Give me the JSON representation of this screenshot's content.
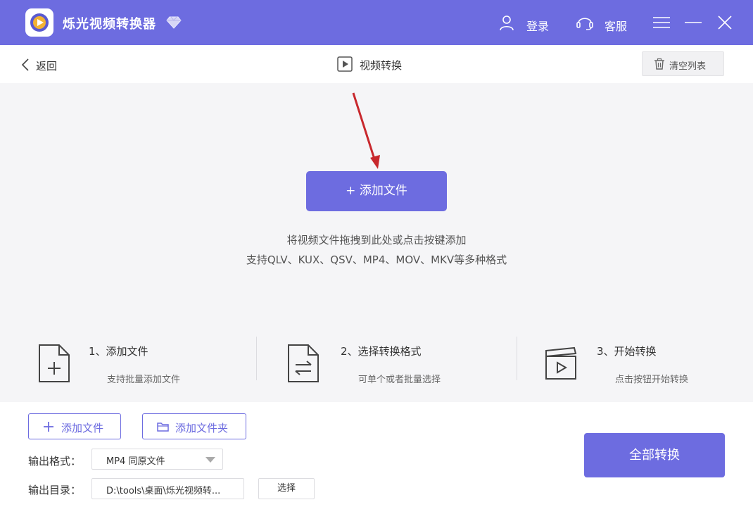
{
  "app": {
    "title": "烁光视频转换器",
    "accent_color": "#6d6ce0",
    "icons": [
      "app-logo",
      "diamond-vip-icon",
      "user-icon",
      "headset-icon",
      "menu-icon",
      "minimize-icon",
      "close-icon"
    ]
  },
  "titlebar": {
    "login_label": "登录",
    "service_label": "客服"
  },
  "subheader": {
    "back_label": "返回",
    "page_title": "视频转换",
    "clear_label": "清空列表"
  },
  "droparea": {
    "add_button_label": "+ 添加文件",
    "hint_line1": "将视频文件拖拽到此处或点击按键添加",
    "hint_line2": "支持QLV、KUX、QSV、MP4、MOV、MKV等多种格式"
  },
  "steps": [
    {
      "title": "1、添加文件",
      "desc": "支持批量添加文件",
      "icon": "add-file-icon"
    },
    {
      "title": "2、选择转换格式",
      "desc": "可单个或者批量选择",
      "icon": "convert-format-icon"
    },
    {
      "title": "3、开始转换",
      "desc": "点击按钮开始转换",
      "icon": "clapperboard-play-icon"
    }
  ],
  "bottom": {
    "add_file_label": "添加文件",
    "add_folder_label": "添加文件夹",
    "output_format_label": "输出格式：",
    "output_format_value": "MP4 同原文件",
    "output_dir_label": "输出目录：",
    "output_dir_value": "D:\\tools\\桌面\\烁光视频转...",
    "choose_label": "选择",
    "convert_all_label": "全部转换"
  }
}
